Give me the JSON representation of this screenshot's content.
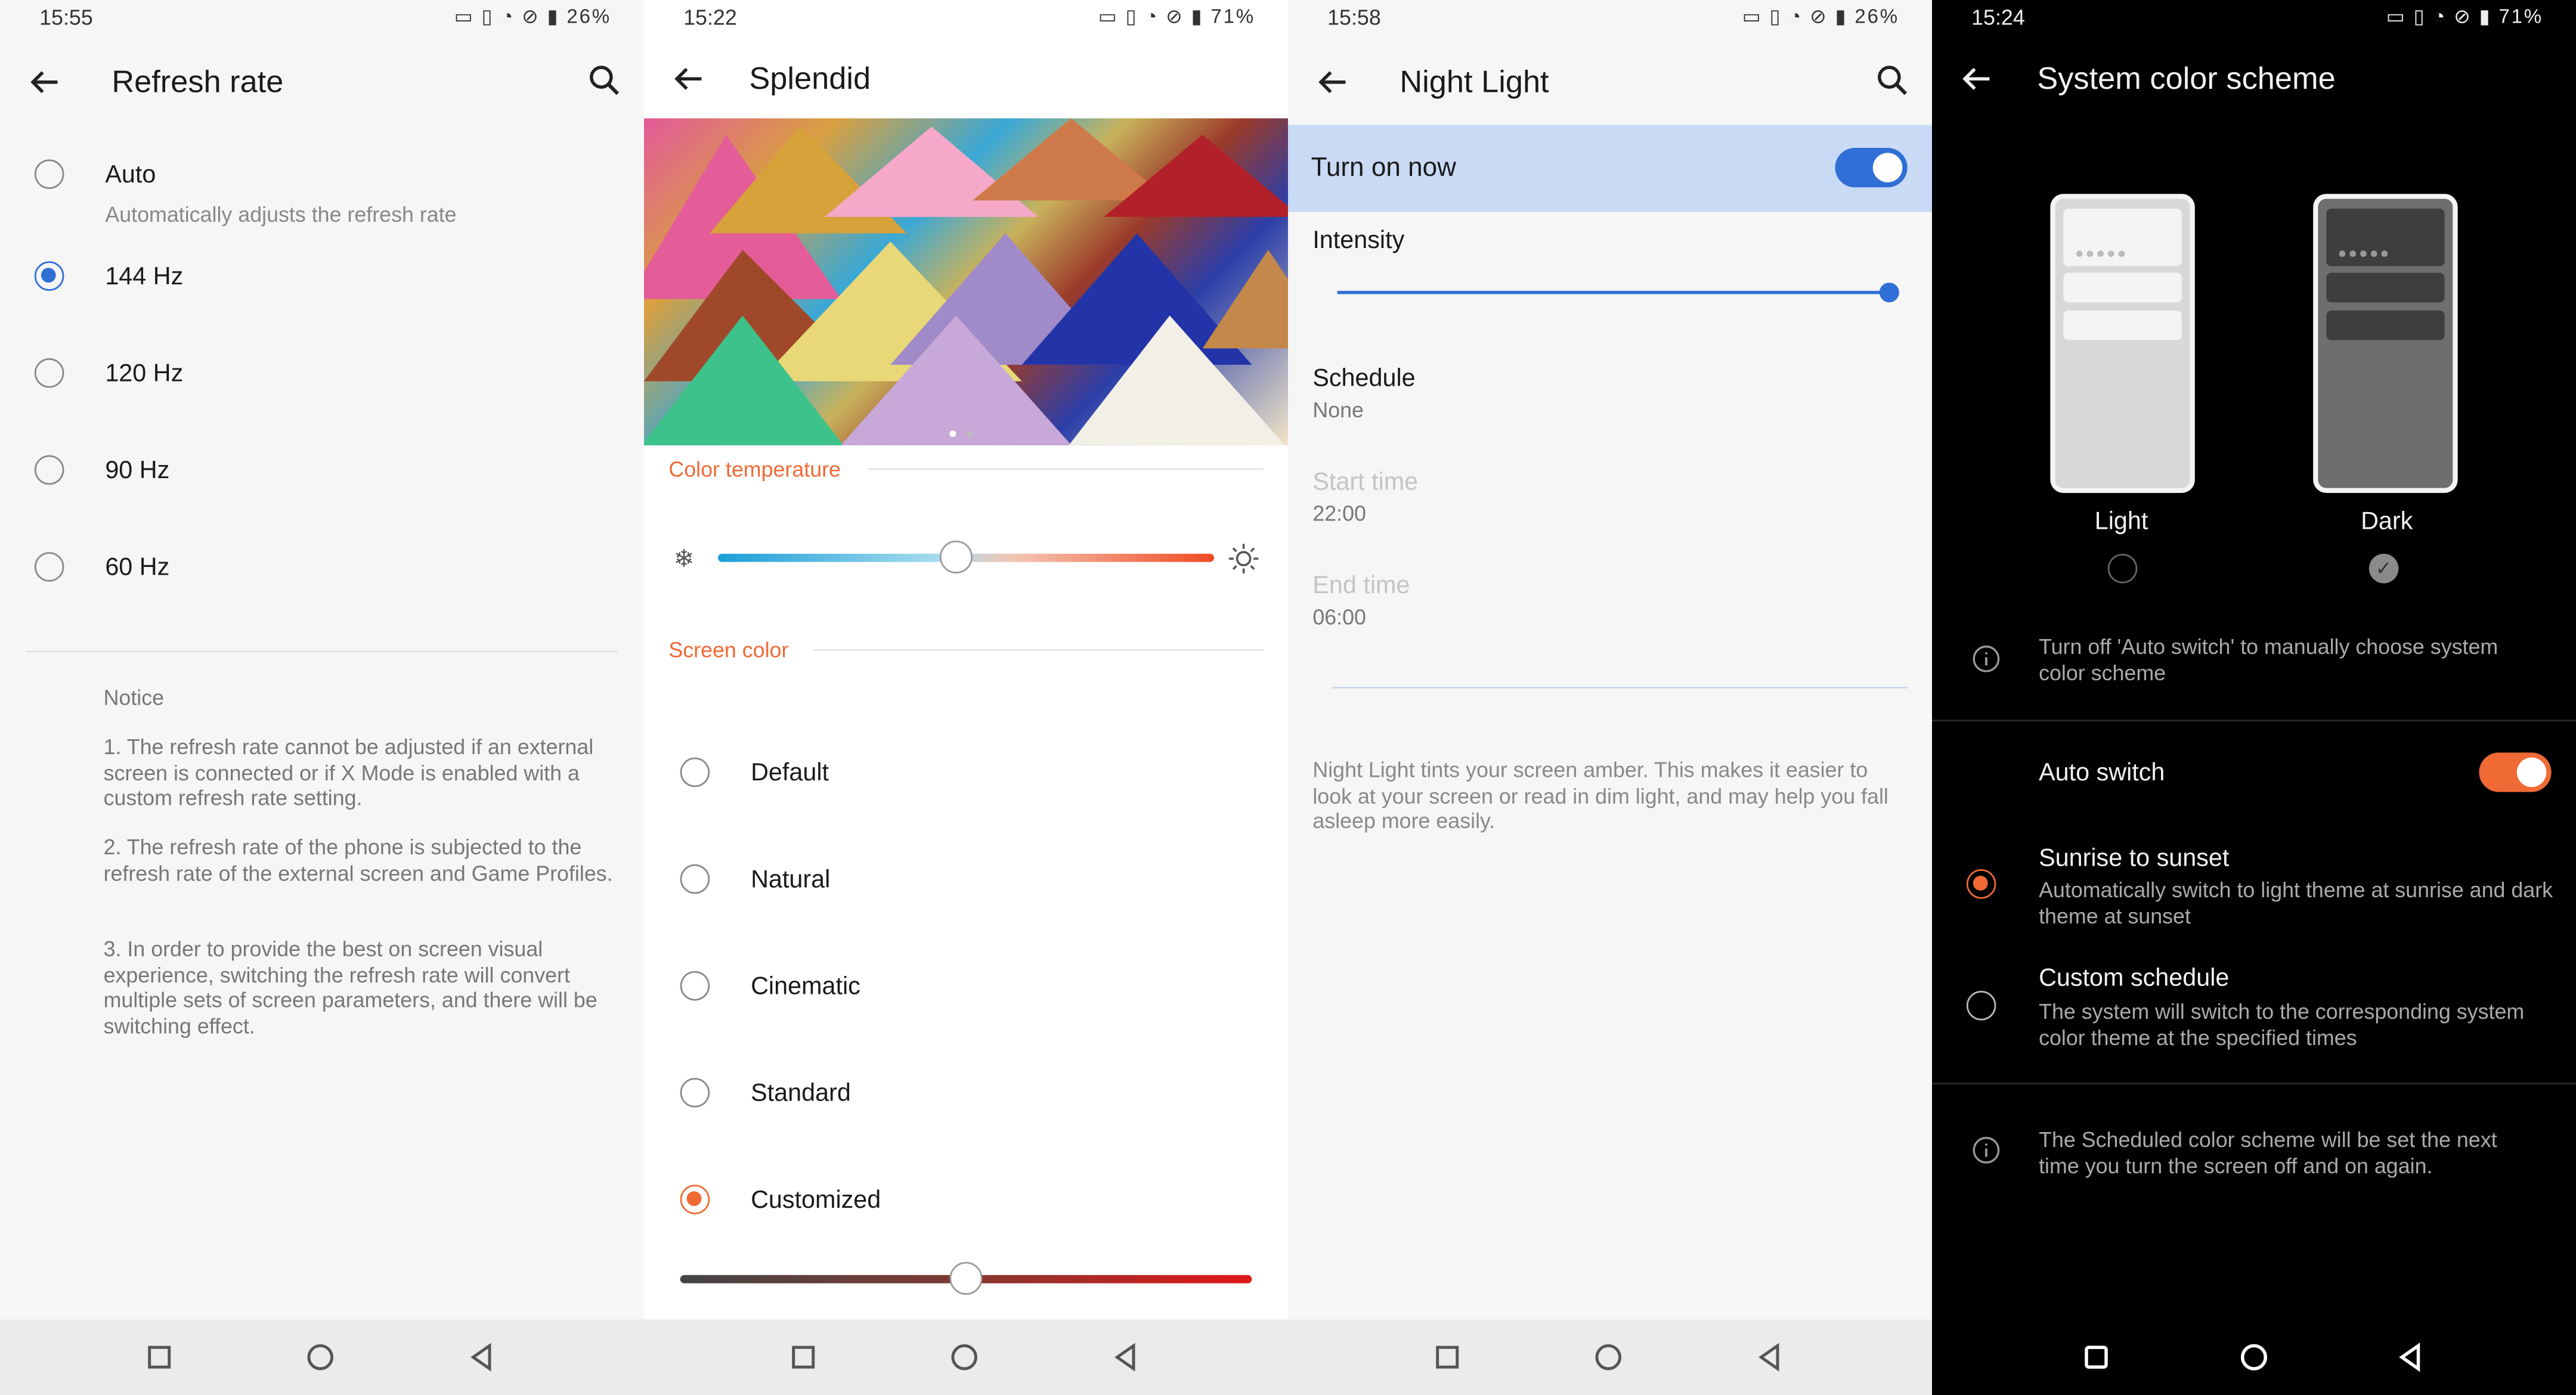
{
  "colors": {
    "blue_accent": "#2f6fd6",
    "orange_accent": "#f06a35",
    "night_highlight": "#c9daf5"
  },
  "panel1": {
    "status": {
      "time": "15:55",
      "battery": "26%"
    },
    "title": "Refresh rate",
    "options": [
      {
        "label": "Auto",
        "desc": "Automatically adjusts the refresh rate",
        "selected": false
      },
      {
        "label": "144 Hz",
        "selected": true
      },
      {
        "label": "120 Hz",
        "selected": false
      },
      {
        "label": "90 Hz",
        "selected": false
      },
      {
        "label": "60 Hz",
        "selected": false
      }
    ],
    "notice_title": "Notice",
    "notices": [
      "1. The refresh rate cannot be adjusted if an external screen is connected or if X Mode is enabled with a custom refresh rate setting.",
      "2. The refresh rate of the phone is subjected to the refresh rate of the external screen and Game Profiles.",
      "3. In order to provide the best on screen visual experience, switching the refresh rate will convert multiple sets of screen parameters, and there will be switching effect."
    ]
  },
  "panel2": {
    "status": {
      "time": "15:22",
      "battery": "71%"
    },
    "title": "Splendid",
    "color_temperature_label": "Color temperature",
    "screen_color_label": "Screen color",
    "color_temperature_value": 0.48,
    "options": [
      {
        "label": "Default",
        "selected": false
      },
      {
        "label": "Natural",
        "selected": false
      },
      {
        "label": "Cinematic",
        "selected": false
      },
      {
        "label": "Standard",
        "selected": false
      },
      {
        "label": "Customized",
        "selected": true
      }
    ],
    "custom_slider_value": 0.5
  },
  "panel3": {
    "status": {
      "time": "15:58",
      "battery": "26%"
    },
    "title": "Night Light",
    "turn_on_now": "Turn on now",
    "intensity_label": "Intensity",
    "intensity_value": 1.0,
    "schedule_label": "Schedule",
    "schedule_value": "None",
    "start_time_label": "Start time",
    "start_time_value": "22:00",
    "end_time_label": "End time",
    "end_time_value": "06:00",
    "description": "Night Light tints your screen amber. This makes it easier to look at your screen or read in dim light, and may help you fall asleep more easily."
  },
  "panel4": {
    "status": {
      "time": "15:24",
      "battery": "71%"
    },
    "title": "System color scheme",
    "light_label": "Light",
    "dark_label": "Dark",
    "info1": "Turn off 'Auto switch' to manually choose system color scheme",
    "auto_switch_label": "Auto switch",
    "sunrise_title": "Sunrise to sunset",
    "sunrise_desc": "Automatically switch to light theme at sunrise and dark theme at sunset",
    "custom_title": "Custom schedule",
    "custom_desc": "The system will switch to the corresponding system color theme at the specified times",
    "info2": "The Scheduled color scheme will be set the next time you turn the screen off and on again."
  }
}
